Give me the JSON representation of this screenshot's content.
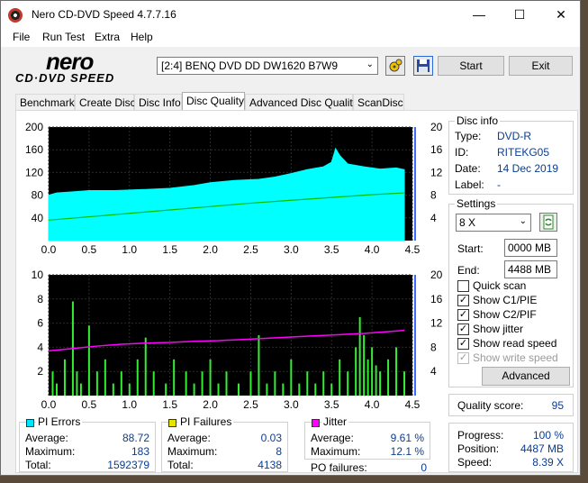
{
  "window": {
    "title": "Nero CD-DVD Speed 4.7.7.16",
    "minimize": "—",
    "maximize": "☐",
    "close": "✕"
  },
  "menu": [
    "File",
    "Run Test",
    "Extra",
    "Help"
  ],
  "logo": {
    "line1": "nero",
    "line2": "CD·DVD SPEED"
  },
  "drive": {
    "selected": "[2:4]   BENQ DVD DD DW1620 B7W9"
  },
  "buttons": {
    "start": "Start",
    "exit": "Exit",
    "advanced": "Advanced"
  },
  "tabs": [
    "Benchmark",
    "Create Disc",
    "Disc Info",
    "Disc Quality",
    "Advanced Disc Quality",
    "ScanDisc"
  ],
  "active_tab": "Disc Quality",
  "disc_info": {
    "header": "Disc info",
    "type_label": "Type:",
    "type": "DVD-R",
    "id_label": "ID:",
    "id": "RITEKG05",
    "date_label": "Date:",
    "date": "14 Dec 2019",
    "label_label": "Label:",
    "label": "-"
  },
  "settings": {
    "header": "Settings",
    "speed": "8 X",
    "start_label": "Start:",
    "start": "0000 MB",
    "end_label": "End:",
    "end": "4488 MB",
    "checks": [
      {
        "label": "Quick scan",
        "checked": false,
        "enabled": true
      },
      {
        "label": "Show C1/PIE",
        "checked": true,
        "enabled": true
      },
      {
        "label": "Show C2/PIF",
        "checked": true,
        "enabled": true
      },
      {
        "label": "Show jitter",
        "checked": true,
        "enabled": true
      },
      {
        "label": "Show read speed",
        "checked": true,
        "enabled": true
      },
      {
        "label": "Show write speed",
        "checked": true,
        "enabled": false
      }
    ]
  },
  "quality": {
    "label": "Quality score:",
    "value": "95"
  },
  "progress": {
    "progress_label": "Progress:",
    "progress": "100 %",
    "position_label": "Position:",
    "position": "4487 MB",
    "speed_label": "Speed:",
    "speed": "8.39 X"
  },
  "pi_errors": {
    "header": "PI Errors",
    "color": "#00e5ff",
    "average_label": "Average:",
    "average": "88.72",
    "maximum_label": "Maximum:",
    "maximum": "183",
    "total_label": "Total:",
    "total": "1592379"
  },
  "pi_failures": {
    "header": "PI Failures",
    "color": "#e5e500",
    "average_label": "Average:",
    "average": "0.03",
    "maximum_label": "Maximum:",
    "maximum": "8",
    "total_label": "Total:",
    "total": "4138"
  },
  "jitter": {
    "header": "Jitter",
    "color": "#ff00ff",
    "average_label": "Average:",
    "average": "9.61 %",
    "maximum_label": "Maximum:",
    "maximum": "12.1 %",
    "po_label": "PO failures:",
    "po": "0"
  },
  "chart_data": [
    {
      "type": "area",
      "name": "top",
      "x_ticks": [
        "0.0",
        "0.5",
        "1.0",
        "1.5",
        "2.0",
        "2.5",
        "3.0",
        "3.5",
        "4.0",
        "4.5"
      ],
      "y_left_ticks": [
        "200",
        "160",
        "120",
        "80",
        "40"
      ],
      "y_right_ticks": [
        "20",
        "16",
        "12",
        "8",
        "4"
      ],
      "xlim": [
        0,
        4.5
      ],
      "ylim_left": [
        0,
        200
      ],
      "ylim_right": [
        0,
        20
      ],
      "series": [
        {
          "color": "#00ffff",
          "points": [
            [
              0,
              80
            ],
            [
              0.1,
              84
            ],
            [
              0.3,
              86
            ],
            [
              0.5,
              88
            ],
            [
              0.8,
              88
            ],
            [
              1.0,
              89
            ],
            [
              1.2,
              90
            ],
            [
              1.5,
              92
            ],
            [
              1.8,
              97
            ],
            [
              2.0,
              102
            ],
            [
              2.3,
              106
            ],
            [
              2.6,
              108
            ],
            [
              2.8,
              112
            ],
            [
              3.0,
              118
            ],
            [
              3.2,
              125
            ],
            [
              3.4,
              130
            ],
            [
              3.5,
              138
            ],
            [
              3.55,
              162
            ],
            [
              3.6,
              150
            ],
            [
              3.7,
              135
            ],
            [
              3.9,
              130
            ],
            [
              4.1,
              126
            ],
            [
              4.3,
              128
            ],
            [
              4.4,
              125
            ]
          ]
        },
        {
          "color": "#00c000",
          "points": [
            [
              0,
              3.6
            ],
            [
              0.5,
              4.2
            ],
            [
              1.0,
              4.8
            ],
            [
              1.5,
              5.4
            ],
            [
              2.0,
              6.0
            ],
            [
              2.5,
              6.6
            ],
            [
              3.0,
              7.1
            ],
            [
              3.5,
              7.6
            ],
            [
              4.0,
              8.1
            ],
            [
              4.4,
              8.4
            ]
          ]
        }
      ]
    },
    {
      "type": "bar",
      "name": "bottom",
      "x_ticks": [
        "0.0",
        "0.5",
        "1.0",
        "1.5",
        "2.0",
        "2.5",
        "3.0",
        "3.5",
        "4.0",
        "4.5"
      ],
      "y_left_ticks": [
        "10",
        "8",
        "6",
        "4",
        "2"
      ],
      "y_right_ticks": [
        "20",
        "16",
        "12",
        "8",
        "4"
      ],
      "xlim": [
        0,
        4.5
      ],
      "ylim_left": [
        0,
        10
      ],
      "ylim_right": [
        0,
        20
      ],
      "series": [
        {
          "color": "#33ee33",
          "points": [
            [
              0.05,
              2
            ],
            [
              0.1,
              1
            ],
            [
              0.2,
              3
            ],
            [
              0.3,
              7.8
            ],
            [
              0.35,
              2
            ],
            [
              0.4,
              1
            ],
            [
              0.5,
              5.8
            ],
            [
              0.6,
              2
            ],
            [
              0.7,
              3
            ],
            [
              0.8,
              1
            ],
            [
              0.9,
              2
            ],
            [
              1.0,
              1
            ],
            [
              1.1,
              3
            ],
            [
              1.2,
              4.8
            ],
            [
              1.3,
              2
            ],
            [
              1.45,
              1
            ],
            [
              1.55,
              3
            ],
            [
              1.7,
              2
            ],
            [
              1.8,
              1
            ],
            [
              1.9,
              2
            ],
            [
              2.0,
              3
            ],
            [
              2.1,
              1
            ],
            [
              2.2,
              2
            ],
            [
              2.35,
              1
            ],
            [
              2.5,
              2
            ],
            [
              2.6,
              5
            ],
            [
              2.7,
              1
            ],
            [
              2.8,
              2
            ],
            [
              2.9,
              1
            ],
            [
              3.0,
              3
            ],
            [
              3.1,
              1
            ],
            [
              3.2,
              2
            ],
            [
              3.3,
              1
            ],
            [
              3.4,
              2
            ],
            [
              3.5,
              1
            ],
            [
              3.6,
              3
            ],
            [
              3.7,
              2
            ],
            [
              3.8,
              4
            ],
            [
              3.85,
              6.5
            ],
            [
              3.9,
              5
            ],
            [
              3.95,
              3
            ],
            [
              4.0,
              4
            ],
            [
              4.05,
              2.5
            ],
            [
              4.1,
              2
            ],
            [
              4.2,
              3
            ],
            [
              4.3,
              4
            ],
            [
              4.4,
              2
            ]
          ]
        },
        {
          "color": "#ff00ff",
          "points": [
            [
              0,
              7.4
            ],
            [
              0.3,
              7.8
            ],
            [
              0.6,
              8.2
            ],
            [
              0.9,
              8.5
            ],
            [
              1.2,
              8.7
            ],
            [
              1.5,
              8.8
            ],
            [
              1.8,
              9.0
            ],
            [
              2.1,
              9.1
            ],
            [
              2.4,
              9.3
            ],
            [
              2.7,
              9.5
            ],
            [
              3.0,
              9.7
            ],
            [
              3.3,
              9.9
            ],
            [
              3.6,
              10.1
            ],
            [
              3.9,
              10.3
            ],
            [
              4.2,
              10.6
            ],
            [
              4.4,
              10.8
            ]
          ]
        }
      ]
    }
  ]
}
